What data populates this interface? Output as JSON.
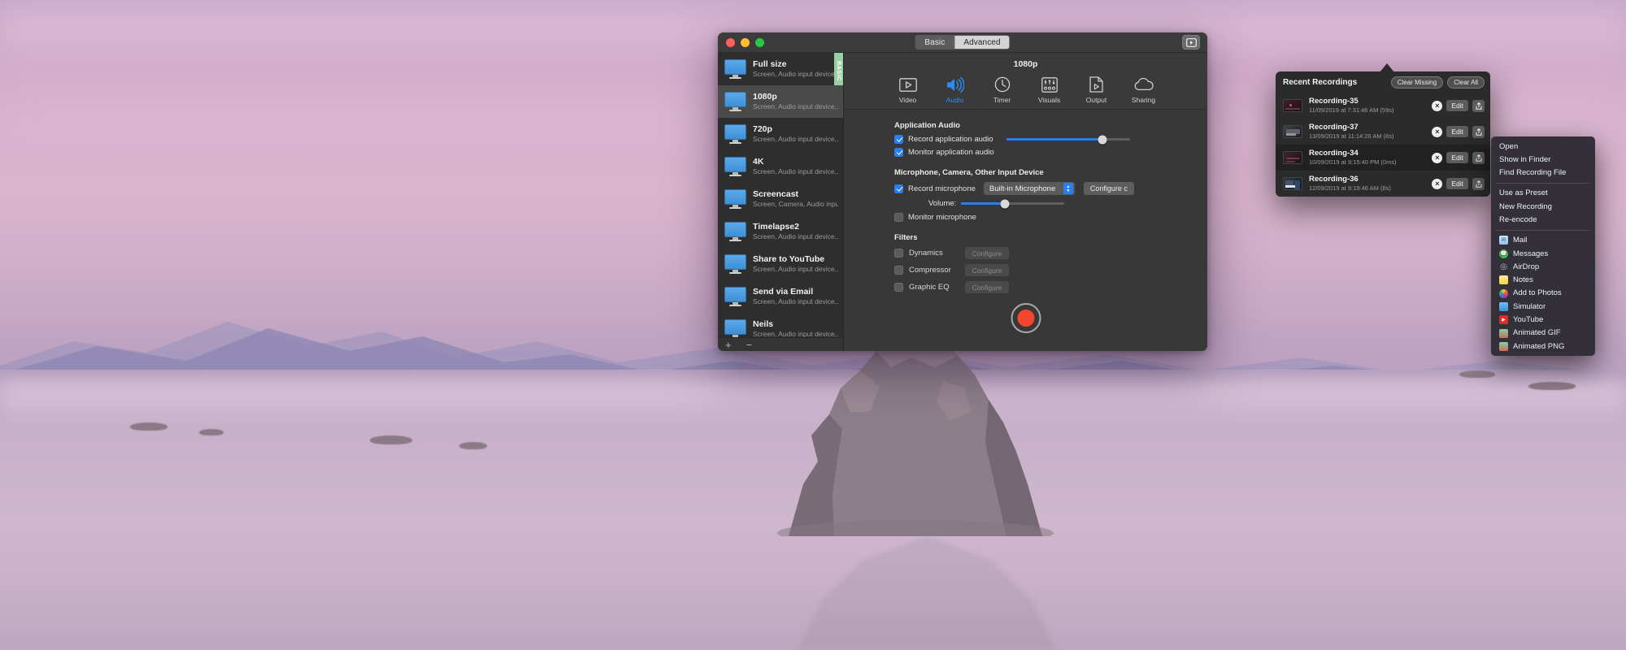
{
  "window": {
    "segmented": {
      "basic": "Basic",
      "advanced": "Advanced",
      "selected": "Advanced"
    },
    "recordings_toolbar_icon": "recordings-icon"
  },
  "sidebar": {
    "tab_label": "BASIC",
    "add_label": "+",
    "remove_label": "−",
    "presets": [
      {
        "name": "Full size",
        "desc": "Screen, Audio input device",
        "selected": false
      },
      {
        "name": "1080p",
        "desc": "Screen, Audio input device,…",
        "selected": true
      },
      {
        "name": "720p",
        "desc": "Screen, Audio input device,…",
        "selected": false
      },
      {
        "name": "4K",
        "desc": "Screen, Audio input device,…",
        "selected": false
      },
      {
        "name": "Screencast",
        "desc": "Screen, Camera, Audio input…",
        "selected": false
      },
      {
        "name": "Timelapse2",
        "desc": "Screen, Audio input device,…",
        "selected": false
      },
      {
        "name": "Share to YouTube",
        "desc": "Screen, Audio input device,…",
        "selected": false
      },
      {
        "name": "Send via Email",
        "desc": "Screen, Audio input device,…",
        "selected": false
      },
      {
        "name": "Neils",
        "desc": "Screen, Audio input device,…",
        "selected": false
      }
    ]
  },
  "main": {
    "preset_title": "1080p",
    "tools": [
      {
        "label": "Video",
        "icon": "video-icon",
        "active": false
      },
      {
        "label": "Audio",
        "icon": "audio-icon",
        "active": true
      },
      {
        "label": "Timer",
        "icon": "timer-icon",
        "active": false
      },
      {
        "label": "Visuals",
        "icon": "visuals-icon",
        "active": false
      },
      {
        "label": "Output",
        "icon": "output-icon",
        "active": false
      },
      {
        "label": "Sharing",
        "icon": "cloud-icon",
        "active": false
      }
    ],
    "app_audio": {
      "title": "Application Audio",
      "record_label": "Record application audio",
      "record_checked": true,
      "record_volume_pct": 78,
      "monitor_label": "Monitor application audio",
      "monitor_checked": true
    },
    "mic_section": {
      "title": "Microphone, Camera, Other Input Device",
      "record_label": "Record microphone",
      "record_checked": true,
      "device_value": "Built-in Microphone",
      "configure_label": "Configure c",
      "volume_label": "Volume:",
      "volume_pct": 42,
      "monitor_label": "Monitor microphone",
      "monitor_checked": false
    },
    "filters": {
      "title": "Filters",
      "items": [
        {
          "name": "Dynamics",
          "checked": false,
          "button": "Configure"
        },
        {
          "name": "Compressor",
          "checked": false,
          "button": "Configure"
        },
        {
          "name": "Graphic EQ",
          "checked": false,
          "button": "Configure"
        }
      ]
    },
    "record_button": "record-button"
  },
  "popover": {
    "title": "Recent Recordings",
    "clear_missing": "Clear Missing",
    "clear_all": "Clear All",
    "edit_label": "Edit",
    "recordings": [
      {
        "name": "Recording-35",
        "date": "11/09/2019 at 7:31:46 AM (59s)"
      },
      {
        "name": "Recording-37",
        "date": "13/09/2019 at 11:14:26 AM (6s)"
      },
      {
        "name": "Recording-34",
        "date": "10/09/2019 at 9:15:40 PM (0ms)"
      },
      {
        "name": "Recording-36",
        "date": "12/09/2019 at 9:19:46 AM (8s)"
      }
    ]
  },
  "context_menu": {
    "group1": [
      "Open",
      "Show in Finder",
      "Find Recording File"
    ],
    "group2": [
      "Use as Preset",
      "New Recording",
      "Re-encode"
    ],
    "group3": [
      {
        "label": "Mail",
        "icon": "mail-icon"
      },
      {
        "label": "Messages",
        "icon": "messages-icon"
      },
      {
        "label": "AirDrop",
        "icon": "airdrop-icon"
      },
      {
        "label": "Notes",
        "icon": "notes-icon"
      },
      {
        "label": "Add to Photos",
        "icon": "photos-icon"
      },
      {
        "label": "Simulator",
        "icon": "simulator-icon"
      },
      {
        "label": "YouTube",
        "icon": "youtube-icon"
      },
      {
        "label": "Animated GIF",
        "icon": "animated-gif-icon"
      },
      {
        "label": "Animated PNG",
        "icon": "animated-png-icon"
      }
    ]
  },
  "colors": {
    "accent_blue": "#2b7ef0",
    "record_red": "#f4452f",
    "basic_tab_green": "#99cfa4",
    "window_bg": "#383838",
    "sidebar_bg": "#2e2e2e"
  }
}
